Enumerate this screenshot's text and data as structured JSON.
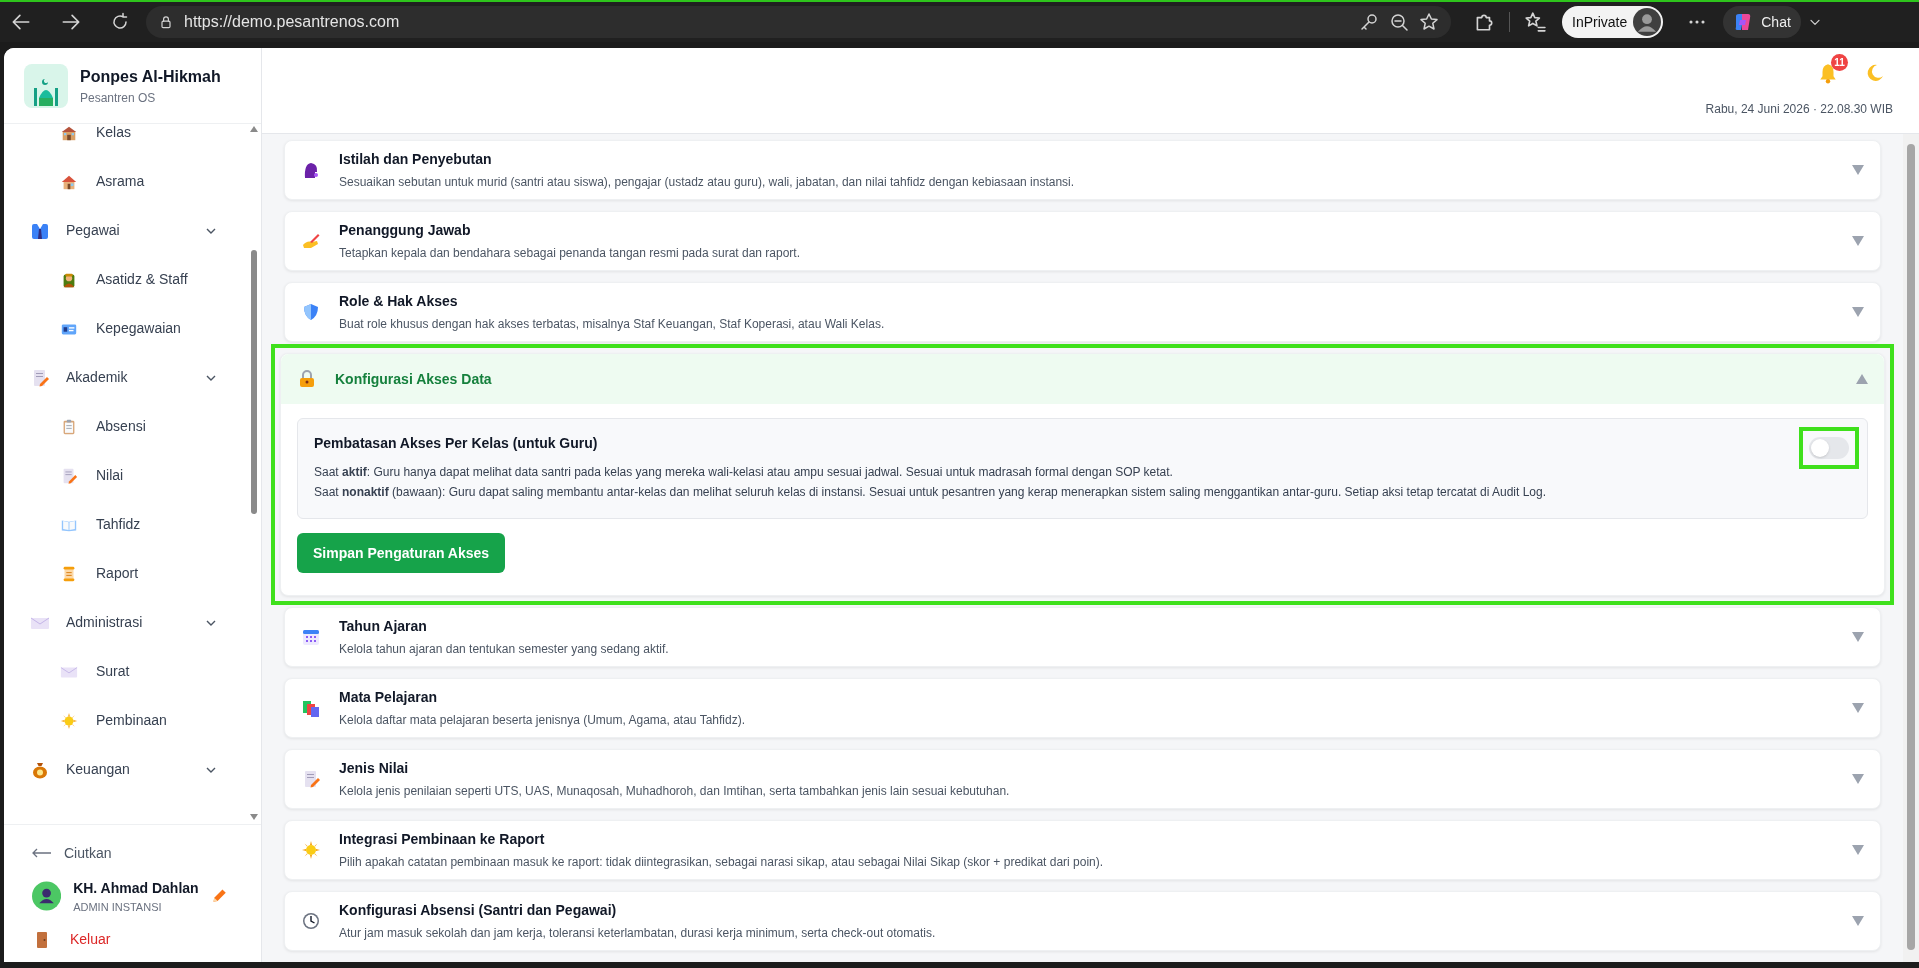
{
  "browser": {
    "url": "https://demo.pesantrenos.com",
    "profile": "InPrivate",
    "chat": "Chat"
  },
  "sidebar": {
    "app_name": "Ponpes Al-Hikmah",
    "app_subtitle": "Pesantren OS",
    "items": [
      {
        "kind": "link",
        "label": "Kelas"
      },
      {
        "kind": "link",
        "label": "Asrama"
      },
      {
        "kind": "group",
        "label": "Pegawai",
        "expanded": true,
        "children": [
          {
            "kind": "link",
            "label": "Asatidz & Staff"
          },
          {
            "kind": "link",
            "label": "Kepegawaian"
          }
        ]
      },
      {
        "kind": "group",
        "label": "Akademik",
        "expanded": true,
        "children": [
          {
            "kind": "link",
            "label": "Absensi"
          },
          {
            "kind": "link",
            "label": "Nilai"
          },
          {
            "kind": "link",
            "label": "Tahfidz"
          },
          {
            "kind": "link",
            "label": "Raport"
          }
        ]
      },
      {
        "kind": "group",
        "label": "Administrasi",
        "expanded": true,
        "children": [
          {
            "kind": "link",
            "label": "Surat"
          },
          {
            "kind": "link",
            "label": "Pembinaan"
          }
        ]
      },
      {
        "kind": "group",
        "label": "Keuangan",
        "expanded": true
      }
    ],
    "collapse": "Ciutkan",
    "user": {
      "name": "KH. Ahmad Dahlan",
      "role": "ADMIN INSTANSI"
    },
    "logout": "Keluar"
  },
  "header": {
    "notifications": "11",
    "datetime": "Rabu, 24 Juni 2026 · 22.08.30 WIB"
  },
  "sections": [
    {
      "title": "Istilah dan Penyebutan",
      "description": "Sesuaikan sebutan untuk murid (santri atau siswa), pengajar (ustadz atau guru), wali, jabatan, dan nilai tahfidz dengan kebiasaan instansi.",
      "expanded": false,
      "highlighted": false
    },
    {
      "title": "Penanggung Jawab",
      "description": "Tetapkan kepala dan bendahara sebagai penanda tangan resmi pada surat dan raport.",
      "expanded": false,
      "highlighted": false
    },
    {
      "title": "Role & Hak Akses",
      "description": "Buat role khusus dengan hak akses terbatas, misalnya Staf Keuangan, Staf Koperasi, atau Wali Kelas.",
      "expanded": false,
      "highlighted": false
    },
    {
      "title": "Konfigurasi Akses Data",
      "expanded": true,
      "highlighted": true,
      "settings": [
        {
          "title": "Pembatasan Akses Per Kelas (untuk Guru)",
          "lines": [
            "Saat **aktif**: Guru hanya dapat melihat data santri pada kelas yang mereka wali-kelasi atau ampu sesuai jadwal. Sesuai untuk madrasah formal dengan SOP ketat.",
            "Saat **nonaktif** (bawaan): Guru dapat saling membantu antar-kelas dan melihat seluruh kelas di instansi. Sesuai untuk pesantren yang kerap menerapkan sistem saling menggantikan antar-guru. Setiap aksi tetap tercatat di Audit Log."
          ],
          "on": false,
          "highlighted": true
        }
      ],
      "save_button": "Simpan Pengaturan Akses"
    },
    {
      "title": "Tahun Ajaran",
      "description": "Kelola tahun ajaran dan tentukan semester yang sedang aktif.",
      "expanded": false,
      "highlighted": false
    },
    {
      "title": "Mata Pelajaran",
      "description": "Kelola daftar mata pelajaran beserta jenisnya (Umum, Agama, atau Tahfidz).",
      "expanded": false,
      "highlighted": false
    },
    {
      "title": "Jenis Nilai",
      "description": "Kelola jenis penilaian seperti UTS, UAS, Munaqosah, Muhadhoroh, dan Imtihan, serta tambahkan jenis lain sesuai kebutuhan.",
      "expanded": false,
      "highlighted": false
    },
    {
      "title": "Integrasi Pembinaan ke Raport",
      "description": "Pilih apakah catatan pembinaan masuk ke raport: tidak diintegrasikan, sebagai narasi sikap, atau sebagai Nilai Sikap (skor + predikat dari poin).",
      "expanded": false,
      "highlighted": false
    },
    {
      "title": "Konfigurasi Absensi (Santri dan Pegawai)",
      "description": "Atur jam masuk sekolah dan jam kerja, toleransi keterlambatan, durasi kerja minimum, serta check-out otomatis.",
      "expanded": false,
      "highlighted": false
    }
  ]
}
